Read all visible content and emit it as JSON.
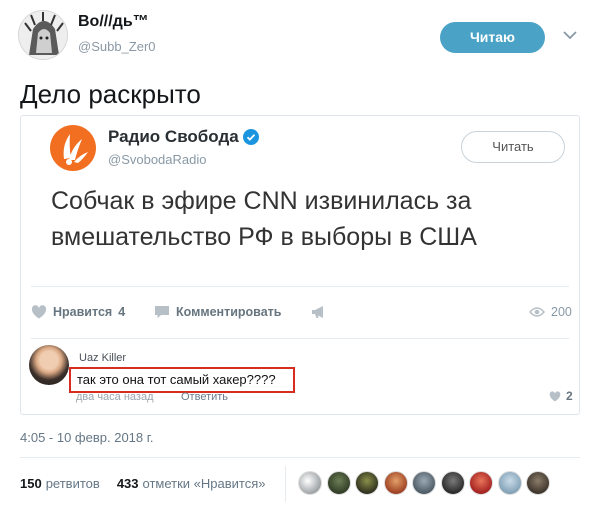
{
  "author": {
    "display_name": "Bo///дь™",
    "handle": "@Subb_Zer0"
  },
  "follow_button": {
    "label": "Читаю"
  },
  "tweet": {
    "text": "Дело раскрыто"
  },
  "quoted_screenshot": {
    "account_name": "Радио Свобода",
    "account_handle": "@SvobodaRadio",
    "verified": true,
    "read_button_label": "Читать",
    "text_lines": [
      "Собчак в эфире CNN извинилась за",
      "вмешательство РФ в выборы в США"
    ],
    "actions": {
      "like_label": "Нравится",
      "like_count": "4",
      "comment_label": "Комментировать",
      "views_count": "200"
    },
    "comment": {
      "author": "Uaz Killer",
      "text": "так это она тот самый хакер????",
      "time": "два часа назад",
      "reply_label": "Ответить",
      "like_count": "2"
    }
  },
  "timestamp": "4:05 - 10 февр. 2018 г.",
  "stats": {
    "retweets_count": "150",
    "retweets_label": "ретвитов",
    "likes_count": "433",
    "likes_label": "отметки «Нравится»"
  },
  "icons": [
    "chevron-down-icon",
    "radio-svoboda-logo",
    "verified-icon",
    "heart-icon",
    "comment-icon",
    "megaphone-icon",
    "eye-icon"
  ],
  "colors": {
    "follow": "#4aa3c6",
    "brand": "#f26f21",
    "verified": "#1b95e0",
    "highlight": "#d62d20",
    "muted": "#657786"
  }
}
